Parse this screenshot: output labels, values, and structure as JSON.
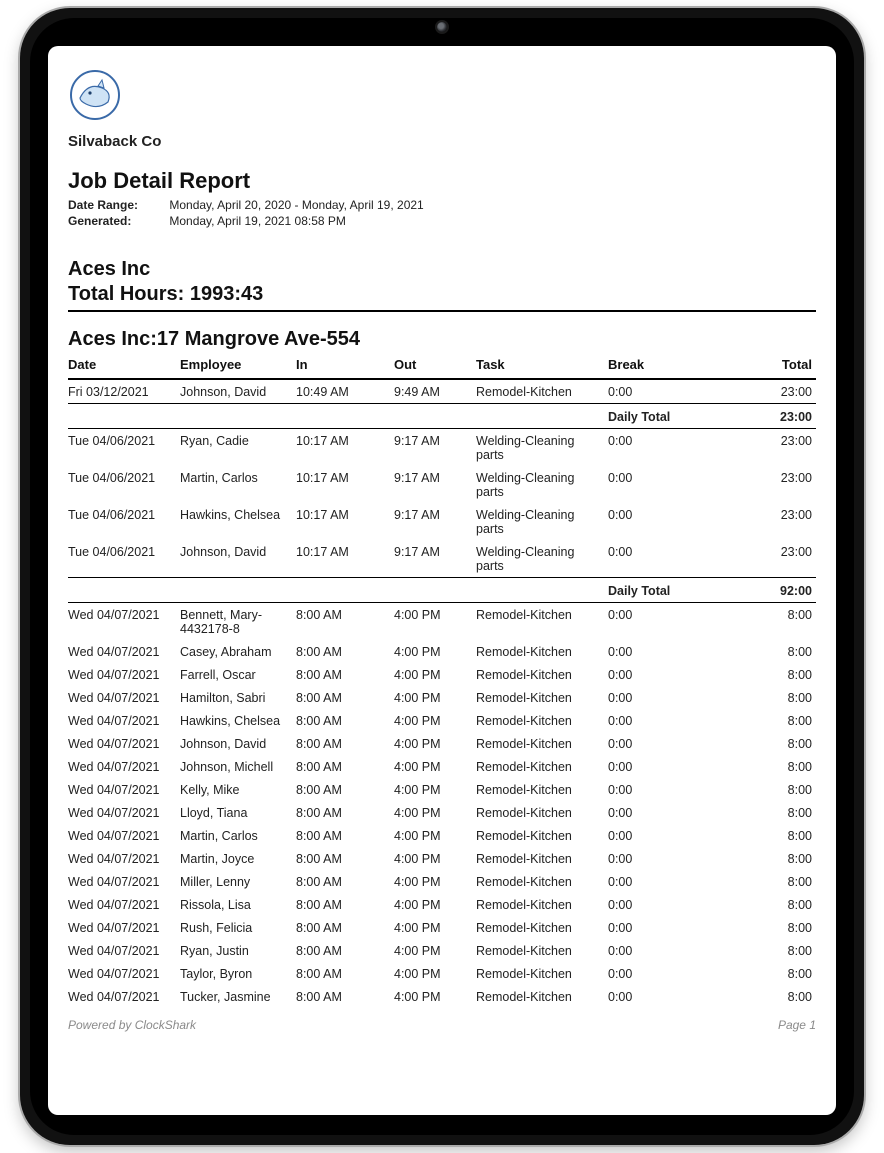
{
  "company": "Silvaback Co",
  "report": {
    "title": "Job Detail Report",
    "date_range_label": "Date Range:",
    "date_range_value": "Monday, April 20, 2020 - Monday, April 19, 2021",
    "generated_label": "Generated:",
    "generated_value": "Monday, April 19, 2021 08:58 PM"
  },
  "customer": {
    "name": "Aces Inc",
    "total_hours_label": "Total Hours:",
    "total_hours_value": "1993:43"
  },
  "job": {
    "title": "Aces Inc:17 Mangrove Ave-554",
    "columns": [
      "Date",
      "Employee",
      "In",
      "Out",
      "Task",
      "Break",
      "Total"
    ],
    "groups": [
      {
        "rows": [
          {
            "date": "Fri 03/12/2021",
            "employee": "Johnson, David",
            "in": "10:49 AM",
            "out": "9:49 AM",
            "task": "Remodel-Kitchen",
            "break": "0:00",
            "total": "23:00"
          }
        ],
        "daily_total_label": "Daily Total",
        "daily_total_value": "23:00"
      },
      {
        "rows": [
          {
            "date": "Tue 04/06/2021",
            "employee": "Ryan, Cadie",
            "in": "10:17 AM",
            "out": "9:17 AM",
            "task": "Welding-Cleaning parts",
            "break": "0:00",
            "total": "23:00"
          },
          {
            "date": "Tue 04/06/2021",
            "employee": "Martin, Carlos",
            "in": "10:17 AM",
            "out": "9:17 AM",
            "task": "Welding-Cleaning parts",
            "break": "0:00",
            "total": "23:00"
          },
          {
            "date": "Tue 04/06/2021",
            "employee": "Hawkins, Chelsea",
            "in": "10:17 AM",
            "out": "9:17 AM",
            "task": "Welding-Cleaning parts",
            "break": "0:00",
            "total": "23:00"
          },
          {
            "date": "Tue 04/06/2021",
            "employee": "Johnson, David",
            "in": "10:17 AM",
            "out": "9:17 AM",
            "task": "Welding-Cleaning parts",
            "break": "0:00",
            "total": "23:00"
          }
        ],
        "daily_total_label": "Daily Total",
        "daily_total_value": "92:00"
      },
      {
        "rows": [
          {
            "date": "Wed 04/07/2021",
            "employee": "Bennett, Mary-4432178-8",
            "in": "8:00 AM",
            "out": "4:00 PM",
            "task": "Remodel-Kitchen",
            "break": "0:00",
            "total": "8:00"
          },
          {
            "date": "Wed 04/07/2021",
            "employee": "Casey, Abraham",
            "in": "8:00 AM",
            "out": "4:00 PM",
            "task": "Remodel-Kitchen",
            "break": "0:00",
            "total": "8:00"
          },
          {
            "date": "Wed 04/07/2021",
            "employee": "Farrell, Oscar",
            "in": "8:00 AM",
            "out": "4:00 PM",
            "task": "Remodel-Kitchen",
            "break": "0:00",
            "total": "8:00"
          },
          {
            "date": "Wed 04/07/2021",
            "employee": "Hamilton, Sabri",
            "in": "8:00 AM",
            "out": "4:00 PM",
            "task": "Remodel-Kitchen",
            "break": "0:00",
            "total": "8:00"
          },
          {
            "date": "Wed 04/07/2021",
            "employee": "Hawkins, Chelsea",
            "in": "8:00 AM",
            "out": "4:00 PM",
            "task": "Remodel-Kitchen",
            "break": "0:00",
            "total": "8:00"
          },
          {
            "date": "Wed 04/07/2021",
            "employee": "Johnson, David",
            "in": "8:00 AM",
            "out": "4:00 PM",
            "task": "Remodel-Kitchen",
            "break": "0:00",
            "total": "8:00"
          },
          {
            "date": "Wed 04/07/2021",
            "employee": "Johnson, Michell",
            "in": "8:00 AM",
            "out": "4:00 PM",
            "task": "Remodel-Kitchen",
            "break": "0:00",
            "total": "8:00"
          },
          {
            "date": "Wed 04/07/2021",
            "employee": "Kelly, Mike",
            "in": "8:00 AM",
            "out": "4:00 PM",
            "task": "Remodel-Kitchen",
            "break": "0:00",
            "total": "8:00"
          },
          {
            "date": "Wed 04/07/2021",
            "employee": "Lloyd, Tiana",
            "in": "8:00 AM",
            "out": "4:00 PM",
            "task": "Remodel-Kitchen",
            "break": "0:00",
            "total": "8:00"
          },
          {
            "date": "Wed 04/07/2021",
            "employee": "Martin, Carlos",
            "in": "8:00 AM",
            "out": "4:00 PM",
            "task": "Remodel-Kitchen",
            "break": "0:00",
            "total": "8:00"
          },
          {
            "date": "Wed 04/07/2021",
            "employee": "Martin, Joyce",
            "in": "8:00 AM",
            "out": "4:00 PM",
            "task": "Remodel-Kitchen",
            "break": "0:00",
            "total": "8:00"
          },
          {
            "date": "Wed 04/07/2021",
            "employee": "Miller, Lenny",
            "in": "8:00 AM",
            "out": "4:00 PM",
            "task": "Remodel-Kitchen",
            "break": "0:00",
            "total": "8:00"
          },
          {
            "date": "Wed 04/07/2021",
            "employee": "Rissola, Lisa",
            "in": "8:00 AM",
            "out": "4:00 PM",
            "task": "Remodel-Kitchen",
            "break": "0:00",
            "total": "8:00"
          },
          {
            "date": "Wed 04/07/2021",
            "employee": "Rush, Felicia",
            "in": "8:00 AM",
            "out": "4:00 PM",
            "task": "Remodel-Kitchen",
            "break": "0:00",
            "total": "8:00"
          },
          {
            "date": "Wed 04/07/2021",
            "employee": "Ryan, Justin",
            "in": "8:00 AM",
            "out": "4:00 PM",
            "task": "Remodel-Kitchen",
            "break": "0:00",
            "total": "8:00"
          },
          {
            "date": "Wed 04/07/2021",
            "employee": "Taylor, Byron",
            "in": "8:00 AM",
            "out": "4:00 PM",
            "task": "Remodel-Kitchen",
            "break": "0:00",
            "total": "8:00"
          },
          {
            "date": "Wed 04/07/2021",
            "employee": "Tucker, Jasmine",
            "in": "8:00 AM",
            "out": "4:00 PM",
            "task": "Remodel-Kitchen",
            "break": "0:00",
            "total": "8:00"
          }
        ]
      }
    ]
  },
  "footer": {
    "left": "Powered by ClockShark",
    "right": "Page 1"
  }
}
